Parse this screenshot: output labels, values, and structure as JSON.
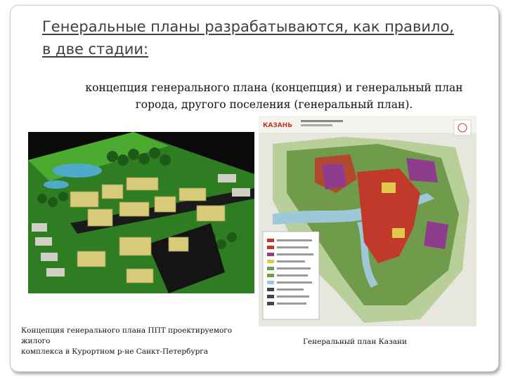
{
  "slide": {
    "title_lines": [
      "Генеральные планы разрабатываются, как правило,",
      "в две стадии:"
    ],
    "subtitle_lines": [
      "концепция генерального плана (концепция) и генеральный план",
      "города, другого поселения (генеральный план)."
    ],
    "left_caption_lines": [
      "Концепция генерального плана ППТ проектируемого жилого",
      "комплекса в Курортном р-не Санкт-Петербурга"
    ],
    "right_caption": "Генеральный план Казани",
    "map_logo_text": "КАЗАНЬ"
  },
  "colors": {
    "title": "#404040",
    "model_background": "#0a0a0a",
    "model_grass": "#3f9a2a",
    "model_buildings": "#d8cc7a",
    "map_background": "#e8e7df",
    "map_green": "#6f9b4a",
    "map_red": "#c0392b",
    "map_purple": "#8e3d8e",
    "map_water": "#9ec7d8"
  }
}
